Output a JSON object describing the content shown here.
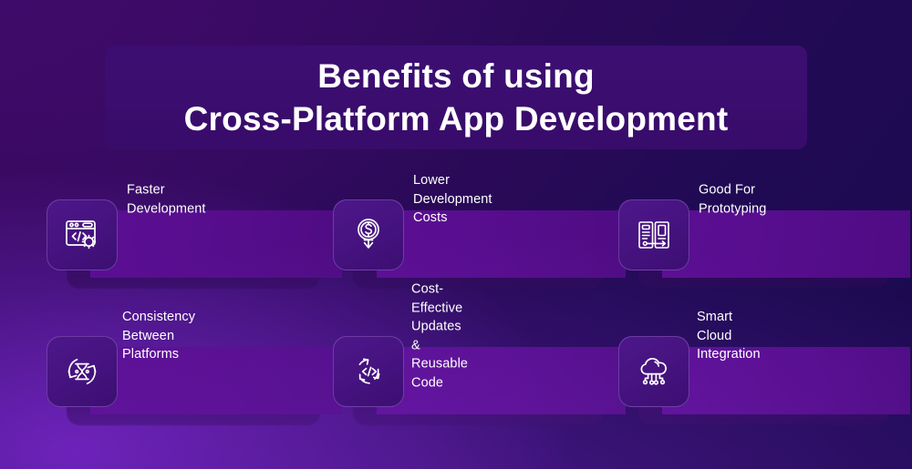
{
  "title": {
    "line1": "Benefits of using",
    "line2": "Cross-Platform App Development"
  },
  "colors": {
    "background_top_left": "#3a0a5e",
    "background_bottom_left": "#6a22b8",
    "background_top_right": "#1a0a50",
    "background_bottom_right": "#1d0a52",
    "banner_fill": "#3c0e72",
    "bar_fill": "#5b0f93",
    "tile_fill": "#461380",
    "tile_border": "#b084e2",
    "text": "#ffffff"
  },
  "benefits": [
    {
      "label": "Faster\nDevelopment",
      "icon": "code-window-gear-icon",
      "row": 0,
      "column": 0
    },
    {
      "label": "Lower\nDevelopment Costs",
      "icon": "dollar-coin-down-arrow-icon",
      "row": 0,
      "column": 1
    },
    {
      "label": "Good For\nPrototyping",
      "icon": "wireframe-screens-arrow-icon",
      "row": 0,
      "column": 2
    },
    {
      "label": "Consistency\nBetween Platforms",
      "icon": "hourglass-sync-icon",
      "row": 1,
      "column": 0
    },
    {
      "label": "Cost-Effective Updates\n& Reusable Code",
      "icon": "code-refresh-cycle-icon",
      "row": 1,
      "column": 1
    },
    {
      "label": "Smart Cloud\nIntegration",
      "icon": "cloud-network-icon",
      "row": 1,
      "column": 2
    }
  ]
}
